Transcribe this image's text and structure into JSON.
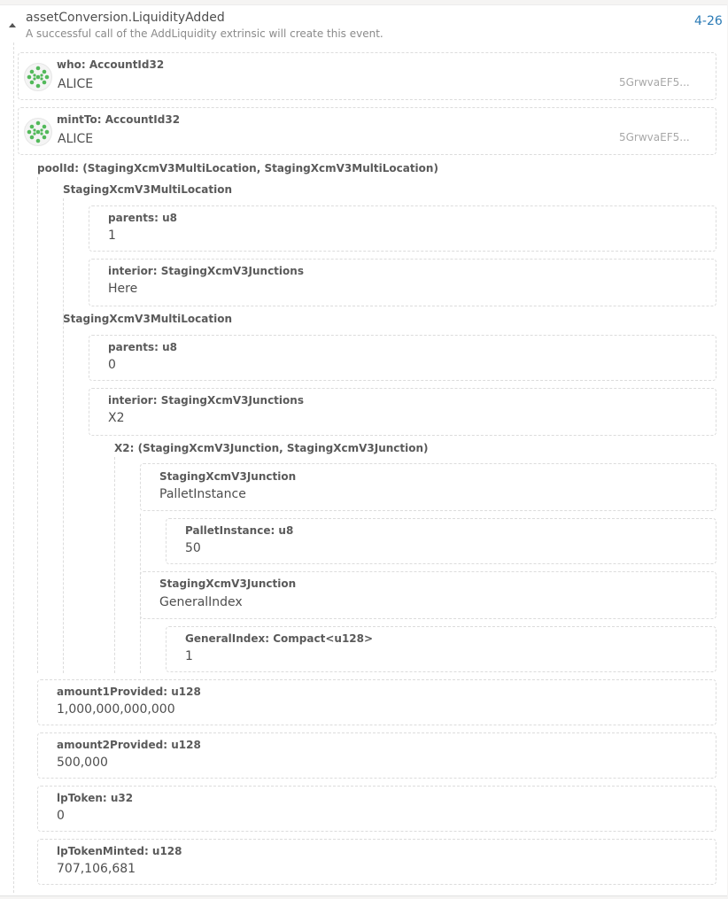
{
  "event": {
    "title": "assetConversion.LiquidityAdded",
    "description": "A successful call of the AddLiquidity extrinsic will create this event.",
    "link": "4-26"
  },
  "who": {
    "label": "who: AccountId32",
    "value": "ALICE",
    "address": "5GrwvaEF5..."
  },
  "mintTo": {
    "label": "mintTo: AccountId32",
    "value": "ALICE",
    "address": "5GrwvaEF5..."
  },
  "poolId": {
    "label": "poolId: (StagingXcmV3MultiLocation, StagingXcmV3MultiLocation)",
    "loc1": {
      "label": "StagingXcmV3MultiLocation",
      "parents_label": "parents: u8",
      "parents_value": "1",
      "interior_label": "interior: StagingXcmV3Junctions",
      "interior_value": "Here"
    },
    "loc2": {
      "label": "StagingXcmV3MultiLocation",
      "parents_label": "parents: u8",
      "parents_value": "0",
      "interior_label": "interior: StagingXcmV3Junctions",
      "interior_value": "X2",
      "x2_label": "X2: (StagingXcmV3Junction, StagingXcmV3Junction)",
      "j1_label": "StagingXcmV3Junction",
      "j1_value": "PalletInstance",
      "j1_inner_label": "PalletInstance: u8",
      "j1_inner_value": "50",
      "j2_label": "StagingXcmV3Junction",
      "j2_value": "GeneralIndex",
      "j2_inner_label": "GeneralIndex: Compact<u128>",
      "j2_inner_value": "1"
    }
  },
  "amount1": {
    "label": "amount1Provided: u128",
    "value": "1,000,000,000,000"
  },
  "amount2": {
    "label": "amount2Provided: u128",
    "value": "500,000"
  },
  "lpToken": {
    "label": "lpToken: u32",
    "value": "0"
  },
  "lpTokenMinted": {
    "label": "lpTokenMinted: u128",
    "value": "707,106,681"
  },
  "colors": {
    "link": "#2a7ab5",
    "identicon": "#52b95a",
    "border": "#dcdcdc"
  },
  "icons": {
    "collapse": "caret-up-icon",
    "avatar": "polkadot-identicon"
  }
}
